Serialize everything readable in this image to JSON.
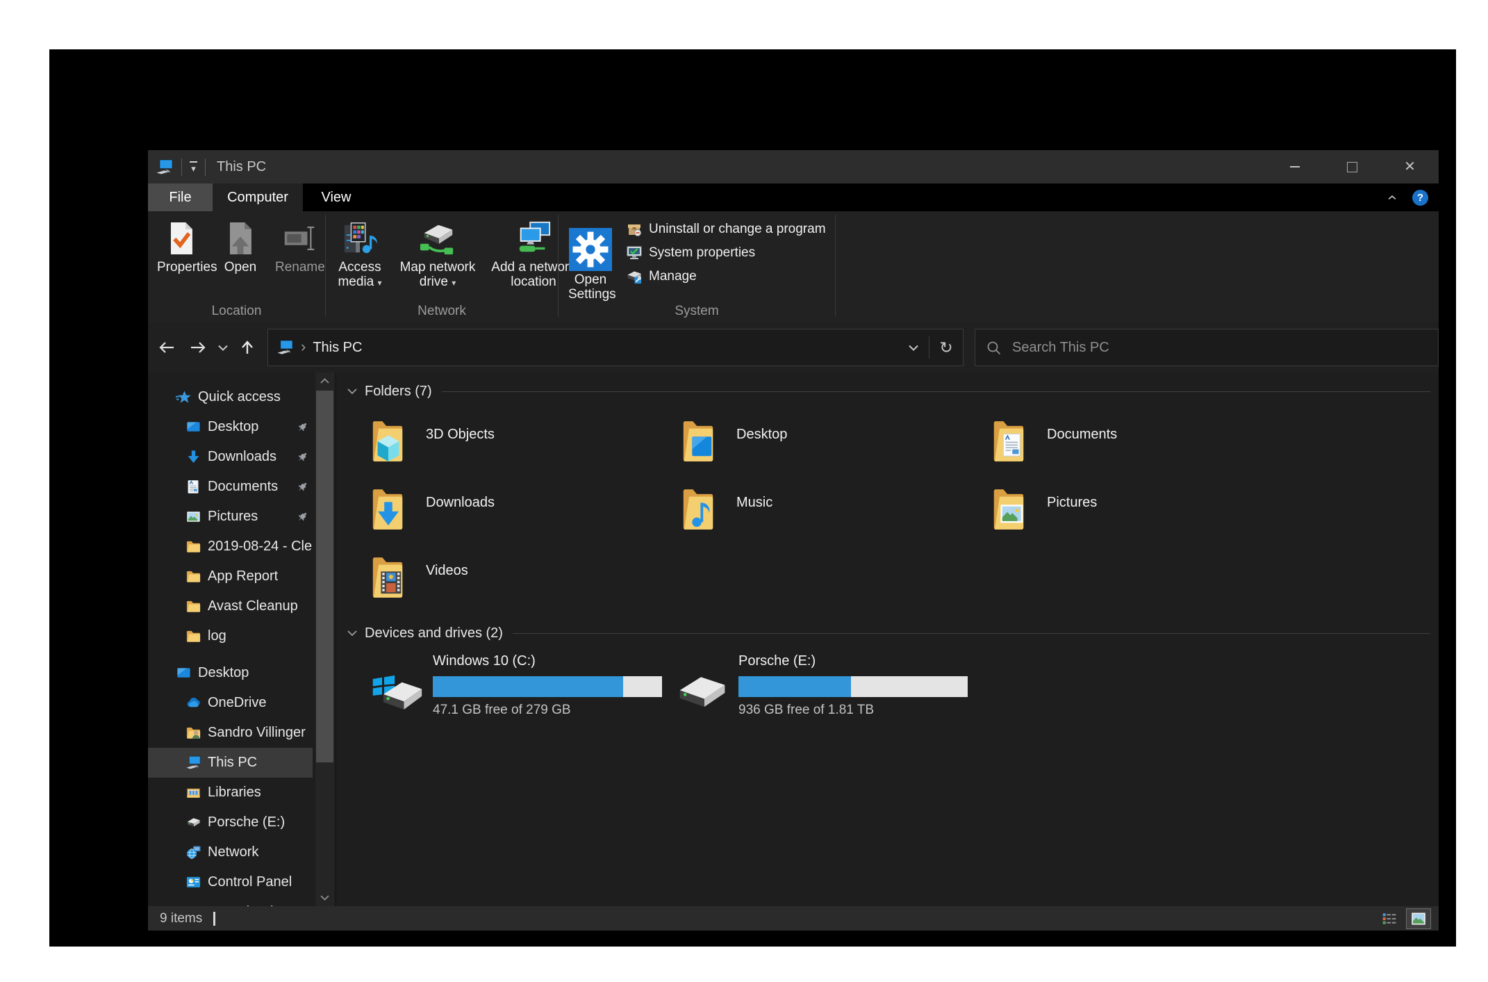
{
  "titlebar": {
    "title": "This PC",
    "app_icon": "this-pc"
  },
  "tabs": [
    {
      "label": "File"
    },
    {
      "label": "Computer",
      "active": true
    },
    {
      "label": "View"
    }
  ],
  "ribbon": {
    "groups": [
      {
        "label": "Location",
        "items": [
          {
            "label": "Properties",
            "icon": "ri-properties"
          },
          {
            "label": "Open",
            "icon": "ri-open"
          },
          {
            "label": "Rename",
            "icon": "ri-rename",
            "disabled": true
          }
        ]
      },
      {
        "label": "Network",
        "items": [
          {
            "label": "Access media",
            "icon": "ri-access-media",
            "dropdown": true
          },
          {
            "label": "Map network drive",
            "icon": "ri-map-drive",
            "dropdown": true
          },
          {
            "label": "Add a network location",
            "icon": "ri-add-network"
          }
        ]
      },
      {
        "label": "System",
        "big": {
          "label": "Open Settings",
          "icon": "ri-settings"
        },
        "small": [
          {
            "label": "Uninstall or change a program",
            "icon": "ri-uninstall"
          },
          {
            "label": "System properties",
            "icon": "ri-sysprops"
          },
          {
            "label": "Manage",
            "icon": "ri-manage"
          }
        ]
      }
    ]
  },
  "navbar": {
    "location": "This PC",
    "search_placeholder": "Search This PC"
  },
  "icons": {
    "refresh": "↻",
    "breadcrumb_chevron": "›",
    "dropdown_arrow": "▾",
    "help": "?",
    "address_dropdown": "⌄"
  },
  "sidebar": {
    "items": [
      {
        "label": "Quick access",
        "icon": "qa-star",
        "depth": 0
      },
      {
        "label": "Desktop",
        "icon": "side-desktop",
        "depth": 1,
        "pinned": true
      },
      {
        "label": "Downloads",
        "icon": "side-downloads",
        "depth": 1,
        "pinned": true
      },
      {
        "label": "Documents",
        "icon": "side-documents",
        "depth": 1,
        "pinned": true
      },
      {
        "label": "Pictures",
        "icon": "side-pictures",
        "depth": 1,
        "pinned": true
      },
      {
        "label": "2019-08-24 - Cle",
        "icon": "side-folder",
        "depth": 1
      },
      {
        "label": "App Report",
        "icon": "side-folder",
        "depth": 1
      },
      {
        "label": "Avast Cleanup",
        "icon": "side-folder",
        "depth": 1
      },
      {
        "label": "log",
        "icon": "side-folder",
        "depth": 1
      },
      {
        "label": "Desktop",
        "icon": "side-desktop",
        "depth": 0,
        "gap_before": true
      },
      {
        "label": "OneDrive",
        "icon": "side-onedrive",
        "depth": 1
      },
      {
        "label": "Sandro Villinger",
        "icon": "side-user",
        "depth": 1
      },
      {
        "label": "This PC",
        "icon": "side-thispc",
        "depth": 1,
        "selected": true
      },
      {
        "label": "Libraries",
        "icon": "side-libraries",
        "depth": 1
      },
      {
        "label": "Porsche (E:)",
        "icon": "side-drive",
        "depth": 1
      },
      {
        "label": "Network",
        "icon": "side-network",
        "depth": 1
      },
      {
        "label": "Control Panel",
        "icon": "side-controlpanel",
        "depth": 1
      },
      {
        "label": "Recycle Bin",
        "icon": "side-recycle",
        "depth": 1
      }
    ]
  },
  "main": {
    "folders": {
      "title": "Folders (7)",
      "tiles": [
        {
          "label": "3D Objects",
          "icon": "tile-3d"
        },
        {
          "label": "Desktop",
          "icon": "tile-desktop"
        },
        {
          "label": "Documents",
          "icon": "tile-documents"
        },
        {
          "label": "Downloads",
          "icon": "tile-downloads"
        },
        {
          "label": "Music",
          "icon": "tile-music"
        },
        {
          "label": "Pictures",
          "icon": "tile-pictures"
        },
        {
          "label": "Videos",
          "icon": "tile-videos"
        }
      ]
    },
    "drives": {
      "title": "Devices and drives (2)",
      "tiles": [
        {
          "label": "Windows 10 (C:)",
          "free_text": "47.1 GB free of 279 GB",
          "used_fraction": 0.83,
          "icon": "drive-windows"
        },
        {
          "label": "Porsche (E:)",
          "free_text": "936 GB free of 1.81 TB",
          "used_fraction": 0.49,
          "icon": "drive-plain"
        }
      ]
    }
  },
  "statusbar": {
    "count": "9 items"
  },
  "colors": {
    "accent_blue": "#2e96dd",
    "folder_yellow": "#f4cf70",
    "bar_fill": "#3296d9",
    "bar_track": "#e4e4e4",
    "selection_bg": "#3a3a3a",
    "help_blue": "#1a73c9",
    "titlebar_bg": "#2d2d2d",
    "ribbon_bg": "#222222",
    "content_bg": "#1e1e1e",
    "statusbar_bg": "#2b2b2b"
  }
}
